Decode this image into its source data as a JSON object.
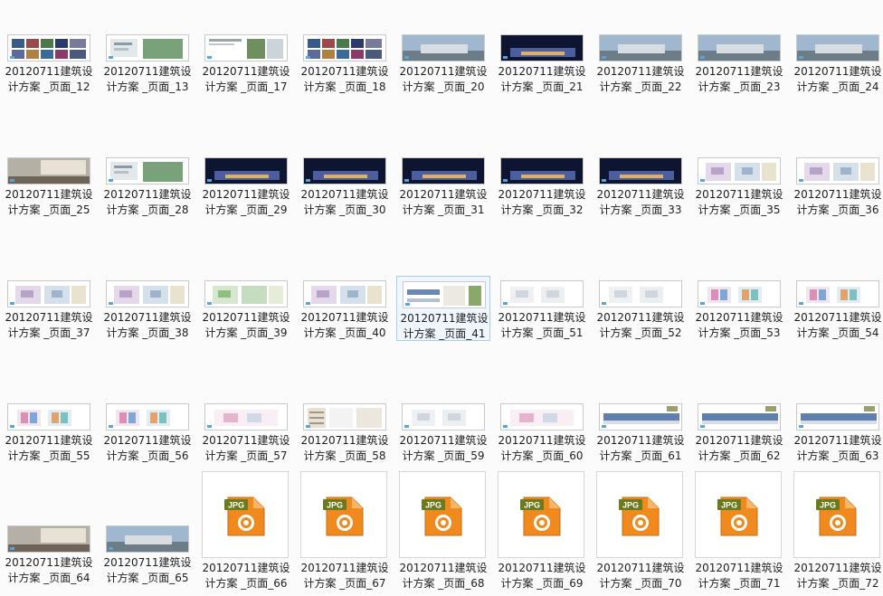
{
  "label_prefix": "20120711建筑设",
  "label_line2_prefix": "计方案 _页面_",
  "selected_page": "41",
  "colors": {
    "background": "#fbfbfb",
    "selection_fill": "#f0f6fd",
    "selection_border": "#a9cdee",
    "jpg_icon_body": "#f08a1e",
    "jpg_icon_badge": "#6b7a1c"
  },
  "jpg_icon": {
    "badge_text": "JPG",
    "icon": "jpg-file-icon"
  },
  "rows": [
    {
      "kind": "thumb",
      "items": [
        {
          "page": "12",
          "style": "collage"
        },
        {
          "page": "13",
          "style": "diagram"
        },
        {
          "page": "17",
          "style": "sheet"
        },
        {
          "page": "18",
          "style": "collage"
        },
        {
          "page": "20",
          "style": "render"
        },
        {
          "page": "21",
          "style": "night"
        },
        {
          "page": "22",
          "style": "render"
        },
        {
          "page": "23",
          "style": "render"
        },
        {
          "page": "24",
          "style": "render"
        }
      ]
    },
    {
      "kind": "thumb",
      "items": [
        {
          "page": "25",
          "style": "interior"
        },
        {
          "page": "28",
          "style": "diagram"
        },
        {
          "page": "29",
          "style": "night"
        },
        {
          "page": "30",
          "style": "night"
        },
        {
          "page": "31",
          "style": "night"
        },
        {
          "page": "32",
          "style": "night"
        },
        {
          "page": "33",
          "style": "night"
        },
        {
          "page": "35",
          "style": "plan"
        },
        {
          "page": "36",
          "style": "plan"
        }
      ]
    },
    {
      "kind": "thumb",
      "items": [
        {
          "page": "37",
          "style": "plan"
        },
        {
          "page": "38",
          "style": "plan"
        },
        {
          "page": "39",
          "style": "plan-green"
        },
        {
          "page": "40",
          "style": "plan"
        },
        {
          "page": "41",
          "style": "section"
        },
        {
          "page": "51",
          "style": "plan-light"
        },
        {
          "page": "52",
          "style": "plan-light"
        },
        {
          "page": "53",
          "style": "plan-color"
        },
        {
          "page": "54",
          "style": "plan-color"
        }
      ]
    },
    {
      "kind": "thumb",
      "items": [
        {
          "page": "55",
          "style": "plan-color"
        },
        {
          "page": "56",
          "style": "plan-color"
        },
        {
          "page": "57",
          "style": "plan-pink"
        },
        {
          "page": "58",
          "style": "table"
        },
        {
          "page": "59",
          "style": "plan-light"
        },
        {
          "page": "60",
          "style": "plan-pink"
        },
        {
          "page": "61",
          "style": "elevation"
        },
        {
          "page": "62",
          "style": "elevation"
        },
        {
          "page": "63",
          "style": "elevation"
        }
      ]
    },
    {
      "kind": "mixed",
      "items": [
        {
          "page": "64",
          "style": "interior"
        },
        {
          "page": "65",
          "style": "render"
        },
        {
          "page": "66",
          "style": "jpg"
        },
        {
          "page": "67",
          "style": "jpg"
        },
        {
          "page": "68",
          "style": "jpg"
        },
        {
          "page": "69",
          "style": "jpg"
        },
        {
          "page": "70",
          "style": "jpg"
        },
        {
          "page": "71",
          "style": "jpg"
        },
        {
          "page": "72",
          "style": "jpg"
        }
      ]
    }
  ]
}
